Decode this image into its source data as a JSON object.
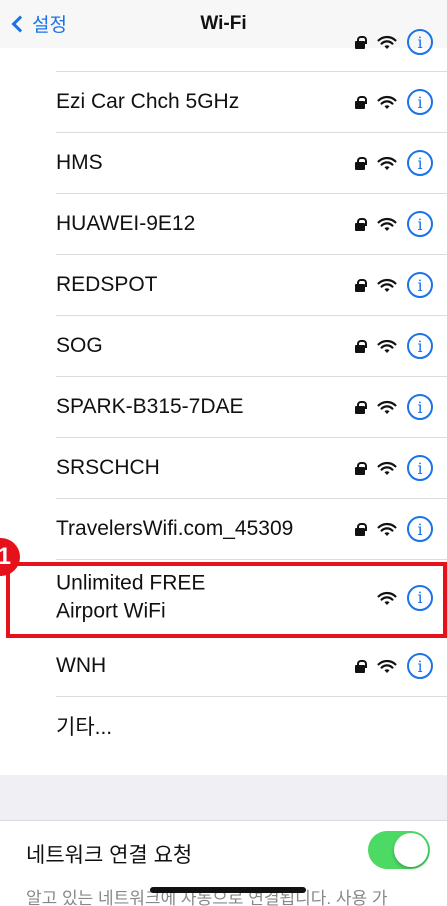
{
  "nav": {
    "back_label": "설정",
    "title": "Wi-Fi"
  },
  "networks": [
    {
      "name": "",
      "locked": true
    },
    {
      "name": "Ezi Car Chch 5GHz",
      "locked": true
    },
    {
      "name": "HMS",
      "locked": true
    },
    {
      "name": "HUAWEI-9E12",
      "locked": true
    },
    {
      "name": "REDSPOT",
      "locked": true
    },
    {
      "name": "SOG",
      "locked": true
    },
    {
      "name": "SPARK-B315-7DAE",
      "locked": true
    },
    {
      "name": "SRSCHCH",
      "locked": true
    },
    {
      "name": "TravelersWifi.com_45309",
      "locked": true
    },
    {
      "name": "Unlimited FREE\nAirport WiFi",
      "locked": false
    },
    {
      "name": "WNH",
      "locked": true
    }
  ],
  "other_label": "기타...",
  "ask_to_join": {
    "label": "네트워크 연결 요청",
    "enabled": true
  },
  "footer_text": "알고 있는 네트워크에 자동으로 연결됩니다. 사용 가",
  "annotation": {
    "marker": "1",
    "color": "#e6121b"
  },
  "colors": {
    "accent": "#1a73e8",
    "toggle_on": "#4cd964"
  }
}
